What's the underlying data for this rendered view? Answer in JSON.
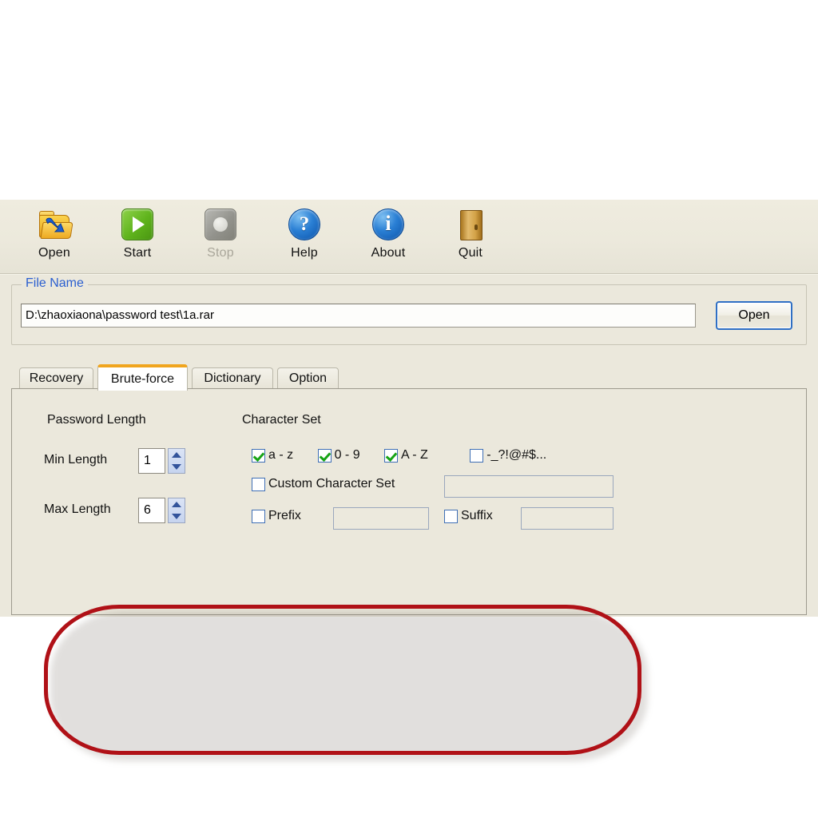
{
  "toolbar": {
    "buttons": [
      {
        "label": "Open",
        "icon": "open-folder-icon",
        "enabled": true
      },
      {
        "label": "Start",
        "icon": "play-icon",
        "enabled": true
      },
      {
        "label": "Stop",
        "icon": "stop-icon",
        "enabled": false
      },
      {
        "label": "Help",
        "icon": "question-mark-icon",
        "enabled": true
      },
      {
        "label": "About",
        "icon": "info-icon",
        "enabled": true
      },
      {
        "label": "Quit",
        "icon": "door-icon",
        "enabled": true
      }
    ]
  },
  "file_name_group": {
    "legend": "File Name",
    "legend_color": "#2b5fd0",
    "path_value": "D:\\zhaoxiaona\\password test\\1a.rar",
    "open_button_label": "Open"
  },
  "tabs": [
    {
      "label": "Recovery",
      "active": false
    },
    {
      "label": "Brute-force",
      "active": true
    },
    {
      "label": "Dictionary",
      "active": false
    },
    {
      "label": "Option",
      "active": false
    }
  ],
  "brute_force": {
    "password_length": {
      "title": "Password Length",
      "min_label": "Min Length",
      "min_value": "1",
      "max_label": "Max Length",
      "max_value": "6"
    },
    "character_set": {
      "title": "Character Set",
      "options": [
        {
          "label": "a - z",
          "checked": true
        },
        {
          "label": "0 - 9",
          "checked": true
        },
        {
          "label": "A - Z",
          "checked": true
        },
        {
          "label": "-_?!@#$...",
          "checked": false
        }
      ],
      "custom": {
        "label": "Custom Character Set",
        "checked": false,
        "value": ""
      },
      "prefix": {
        "label": "Prefix",
        "checked": false,
        "value": ""
      },
      "suffix": {
        "label": "Suffix",
        "checked": false,
        "value": ""
      }
    }
  },
  "annotation": {
    "shape": "rounded-rectangle-highlight",
    "color": "#b01117"
  }
}
